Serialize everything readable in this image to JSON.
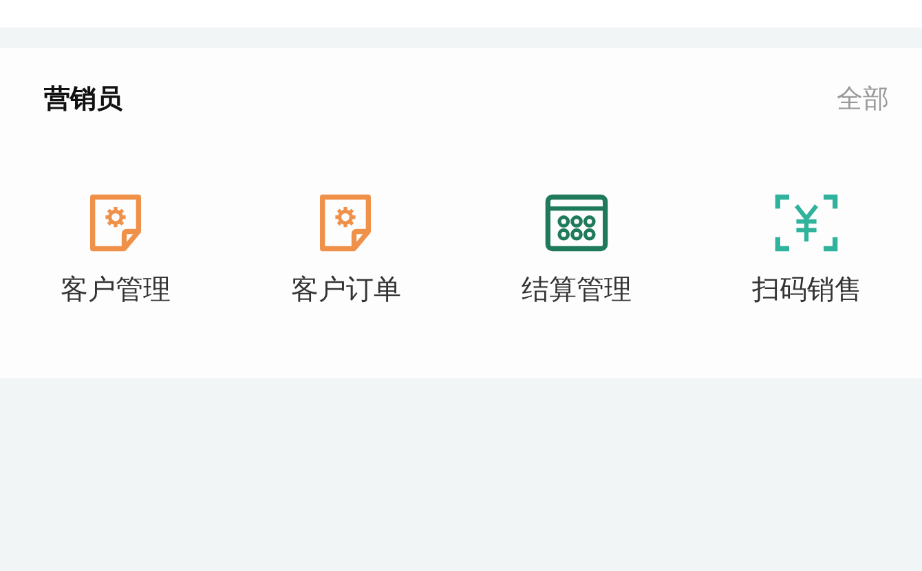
{
  "section": {
    "title": "营销员",
    "more": "全部"
  },
  "items": [
    {
      "label": "客户管理",
      "kind": "doc-gear"
    },
    {
      "label": "客户订单",
      "kind": "doc-gear"
    },
    {
      "label": "结算管理",
      "kind": "calculator"
    },
    {
      "label": "扫码销售",
      "kind": "scan-yen"
    }
  ]
}
